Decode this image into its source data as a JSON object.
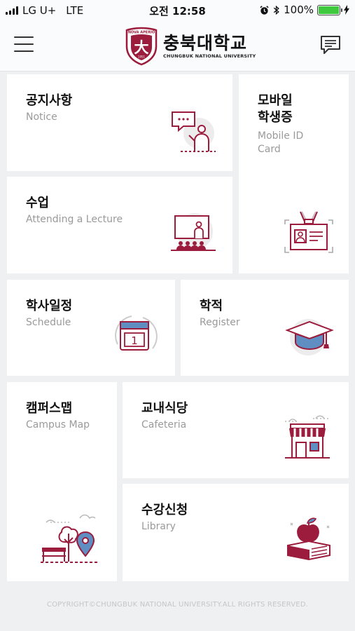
{
  "status_bar": {
    "carrier": "LG U+",
    "network": "LTE",
    "time": "오전 12:58",
    "battery": "100%",
    "battery_level": 1.0
  },
  "header": {
    "logo_ko": "충북대학교",
    "logo_en": "CHUNGBUK NATIONAL UNIVERSITY",
    "emblem_motto": "NOVA APERIO",
    "emblem_char": "大",
    "emblem_year": "1951"
  },
  "tiles": {
    "notice": {
      "ko": "공지사항",
      "en": "Notice"
    },
    "mobile_id": {
      "ko_line1": "모바일",
      "ko_line2": "학생증",
      "en_line1": "Mobile ID",
      "en_line2": "Card"
    },
    "lecture": {
      "ko": "수업",
      "en": "Attending a Lecture"
    },
    "schedule": {
      "ko": "학사일정",
      "en": "Schedule",
      "calendar_day": "1"
    },
    "register": {
      "ko": "학적",
      "en": "Register"
    },
    "campus_map": {
      "ko": "캠퍼스맵",
      "en": "Campus Map"
    },
    "cafeteria": {
      "ko": "교내식당",
      "en": "Cafeteria"
    },
    "course_registration": {
      "ko": "수강신청",
      "en": "Library"
    }
  },
  "footer": {
    "copyright": "COPYRIGHT©CHUNGBUK NATIONAL UNIVERSITY.ALL RIGHTS RESERVED."
  },
  "colors": {
    "accent": "#9b1c3c",
    "tile_bg": "#ffffff",
    "page_bg": "#eef0f2",
    "subtitle": "#9a9a9a"
  }
}
